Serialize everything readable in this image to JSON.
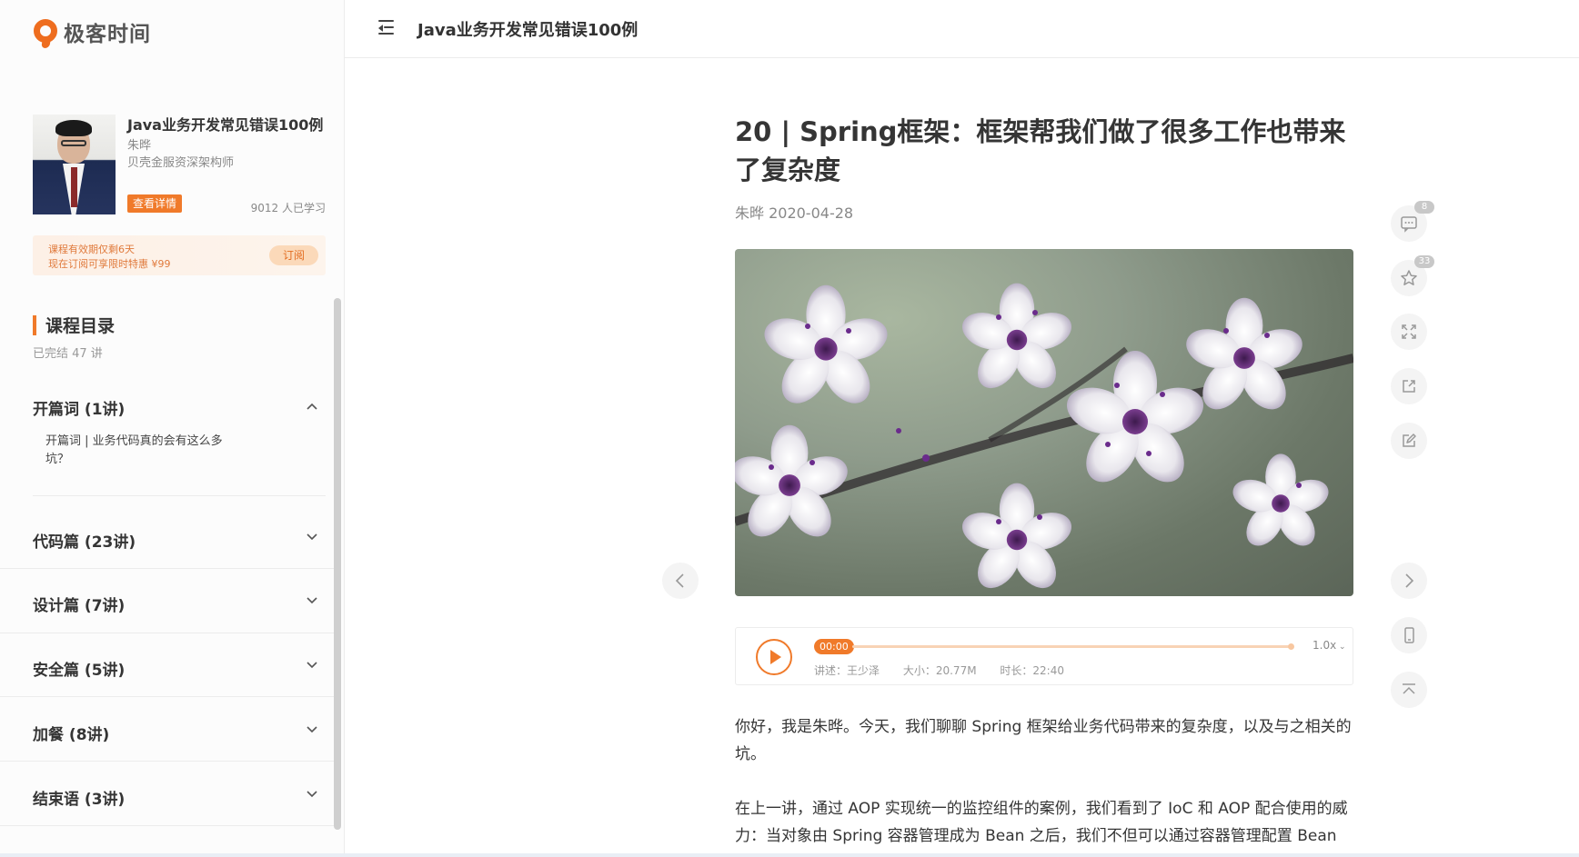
{
  "brand": {
    "name": "极客时间",
    "accent": "#f07a2a"
  },
  "header": {
    "title": "Java业务开发常见错误100例",
    "menu_icon": "menu-collapse-icon"
  },
  "course": {
    "title": "Java业务开发常见错误100例",
    "author": "朱晔",
    "role": "贝壳金服资深架构师",
    "detail_label": "查看详情",
    "learners": "9012 人已学习"
  },
  "promo": {
    "line1": "课程有效期仅剩6天",
    "line2": "现在订阅可享限时特惠 ¥99",
    "button": "订阅"
  },
  "toc": {
    "title": "课程目录",
    "subtitle": "已完结 47 讲",
    "chapters": [
      {
        "label": "开篇词 (1讲)",
        "expanded": true,
        "lessons": [
          "开篇词 | 业务代码真的会有这么多坑？"
        ]
      },
      {
        "label": "代码篇 (23讲)",
        "expanded": false
      },
      {
        "label": "设计篇 (7讲)",
        "expanded": false
      },
      {
        "label": "安全篇 (5讲)",
        "expanded": false
      },
      {
        "label": "加餐 (8讲)",
        "expanded": false
      },
      {
        "label": "结束语 (3讲)",
        "expanded": false
      }
    ]
  },
  "article": {
    "title": "20 | Spring框架：框架帮我们做了很多工作也带来了复杂度",
    "meta": "朱晔 2020-04-28",
    "paragraphs": [
      "你好，我是朱晔。今天，我们聊聊 Spring 框架给业务代码带来的复杂度，以及与之相关的坑。",
      "在上一讲，通过 AOP 实现统一的监控组件的案例，我们看到了 IoC 和 AOP 配合使用的威力：当对象由 Spring 容器管理成为 Bean 之后，我们不但可以通过容器管理配置 Bean 的"
    ]
  },
  "audio": {
    "current_time": "00:00",
    "speed": "1.0x",
    "speaker": "讲述：王少泽",
    "size": "大小：20.77M",
    "duration": "时长：22:40",
    "progress": 0
  },
  "tools": {
    "comments_count": "8",
    "favorites_count": "33"
  }
}
